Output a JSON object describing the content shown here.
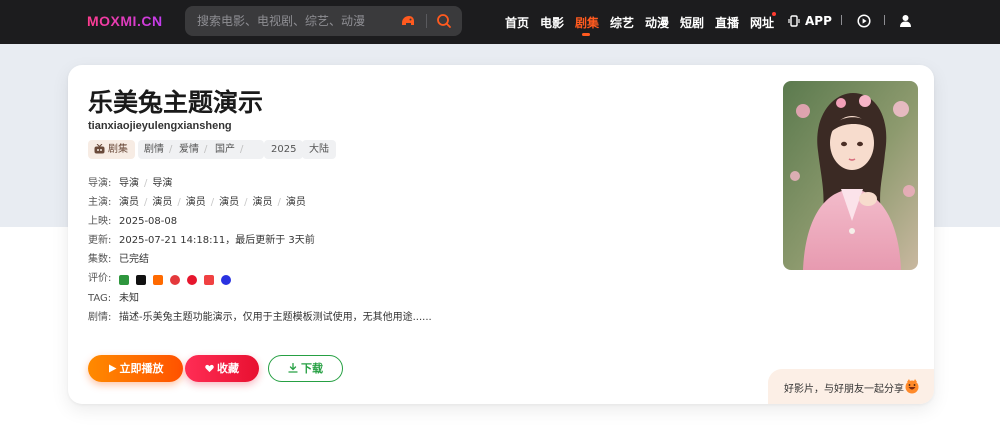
{
  "header": {
    "logo": "MOXMI.CN",
    "search_placeholder": "搜索电影、电视剧、综艺、动漫",
    "nav": [
      {
        "label": "首页"
      },
      {
        "label": "电影"
      },
      {
        "label": "剧集",
        "active": true
      },
      {
        "label": "综艺"
      },
      {
        "label": "动漫"
      },
      {
        "label": "短剧"
      },
      {
        "label": "直播"
      },
      {
        "label": "网址"
      },
      {
        "label": "APP"
      }
    ],
    "accent_color": "#ff5a1f"
  },
  "detail": {
    "title": "乐美兔主题演示",
    "subtitle": "tianxiaojieyulengxiansheng",
    "type_tag": "剧集",
    "genres": [
      "剧情",
      "爱情",
      "国产"
    ],
    "year": "2025",
    "region": "大陆",
    "director_label": "导演:",
    "directors": [
      "导演",
      "导演"
    ],
    "cast_label": "主演:",
    "cast": [
      "演员",
      "演员",
      "演员",
      "演员",
      "演员",
      "演员"
    ],
    "release_label": "上映:",
    "release": "2025-08-08",
    "update_label": "更新:",
    "update": "2025-07-21 14:18:11，最后更新于 3天前",
    "episodes_label": "集数:",
    "episodes": "已完结",
    "rating_label": "评价:",
    "rating_icons": [
      "douban-icon",
      "douyin-icon",
      "xiaohongshu-icon",
      "kuaishou-icon",
      "weibo-icon",
      "toutiao-icon",
      "baidu-icon"
    ],
    "tag_label": "TAG:",
    "tag_value": "未知",
    "plot_label": "剧情:",
    "plot": "描述-乐美兔主题功能演示，仅用于主题模板测试使用，无其他用途......"
  },
  "actions": {
    "play": "立即播放",
    "favorite": "收藏",
    "download": "下载"
  },
  "share": {
    "text": "好影片，与好朋友一起分享"
  }
}
